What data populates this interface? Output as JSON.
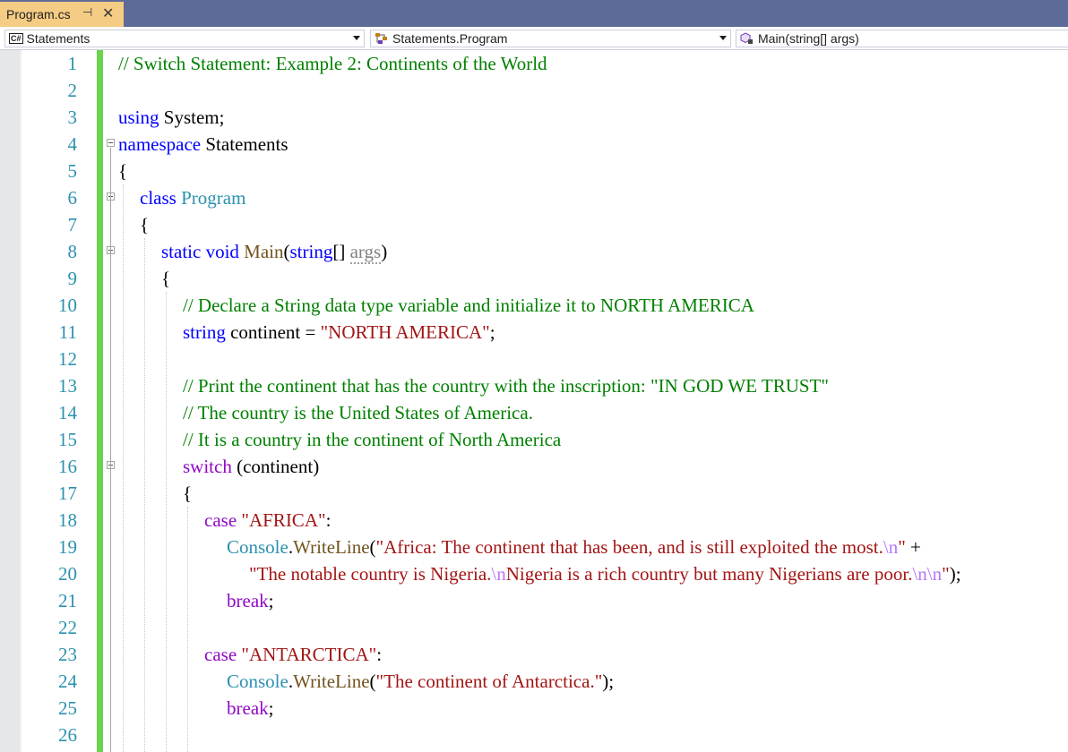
{
  "tab": {
    "title": "Program.cs",
    "pin_glyph": "⊣",
    "close_glyph": "✕"
  },
  "navbar": {
    "project": "Statements",
    "type": "Statements.Program",
    "member": "Main(string[] args)"
  },
  "lines": [
    {
      "n": "1",
      "indent": 0,
      "tokens": [
        [
          "c-comment",
          "// Switch Statement: Example 2: Continents of the World"
        ]
      ]
    },
    {
      "n": "2",
      "indent": 0,
      "tokens": []
    },
    {
      "n": "3",
      "indent": 0,
      "tokens": [
        [
          "c-kw",
          "using"
        ],
        [
          "",
          " System;"
        ]
      ]
    },
    {
      "n": "4",
      "indent": 0,
      "fold": true,
      "tokens": [
        [
          "c-kw",
          "namespace"
        ],
        [
          "",
          " Statements"
        ]
      ]
    },
    {
      "n": "5",
      "indent": 0,
      "tokens": [
        [
          "",
          "{"
        ]
      ]
    },
    {
      "n": "6",
      "indent": 1,
      "fold": true,
      "tokens": [
        [
          "c-kw",
          "class"
        ],
        [
          "",
          " "
        ],
        [
          "c-type",
          "Program"
        ]
      ]
    },
    {
      "n": "7",
      "indent": 1,
      "tokens": [
        [
          "",
          "{"
        ]
      ]
    },
    {
      "n": "8",
      "indent": 2,
      "fold": true,
      "tokens": [
        [
          "c-kw",
          "static"
        ],
        [
          "",
          " "
        ],
        [
          "c-kw",
          "void"
        ],
        [
          "",
          " "
        ],
        [
          "c-method",
          "Main"
        ],
        [
          "",
          "("
        ],
        [
          "c-kw",
          "string"
        ],
        [
          "",
          "[] "
        ],
        [
          "c-param",
          "args"
        ],
        [
          "",
          ")"
        ]
      ]
    },
    {
      "n": "9",
      "indent": 2,
      "tokens": [
        [
          "",
          "{"
        ]
      ]
    },
    {
      "n": "10",
      "indent": 3,
      "tokens": [
        [
          "c-comment",
          "// Declare a String data type variable and initialize it to NORTH AMERICA"
        ]
      ]
    },
    {
      "n": "11",
      "indent": 3,
      "tokens": [
        [
          "c-kw",
          "string"
        ],
        [
          "",
          " continent = "
        ],
        [
          "c-str",
          "\"NORTH AMERICA\""
        ],
        [
          "",
          ";"
        ]
      ]
    },
    {
      "n": "12",
      "indent": 3,
      "tokens": []
    },
    {
      "n": "13",
      "indent": 3,
      "tokens": [
        [
          "c-comment",
          "// Print the continent that has the country with the inscription: \"IN GOD WE TRUST\""
        ]
      ]
    },
    {
      "n": "14",
      "indent": 3,
      "tokens": [
        [
          "c-comment",
          "// The country is the United States of America."
        ]
      ]
    },
    {
      "n": "15",
      "indent": 3,
      "tokens": [
        [
          "c-comment",
          "// It is a country in the continent of North America"
        ]
      ]
    },
    {
      "n": "16",
      "indent": 3,
      "fold": true,
      "tokens": [
        [
          "c-ctrl",
          "switch"
        ],
        [
          "",
          " (continent)"
        ]
      ]
    },
    {
      "n": "17",
      "indent": 3,
      "tokens": [
        [
          "",
          "{"
        ]
      ]
    },
    {
      "n": "18",
      "indent": 4,
      "tokens": [
        [
          "c-ctrl",
          "case"
        ],
        [
          "",
          " "
        ],
        [
          "c-str",
          "\"AFRICA\""
        ],
        [
          "",
          ":"
        ]
      ]
    },
    {
      "n": "19",
      "indent": 5,
      "tokens": [
        [
          "c-type",
          "Console"
        ],
        [
          "",
          "."
        ],
        [
          "c-method",
          "WriteLine"
        ],
        [
          "",
          "("
        ],
        [
          "c-str",
          "\"Africa: The continent that has been, and is still exploited the most."
        ],
        [
          "c-esc",
          "\\n"
        ],
        [
          "c-str",
          "\""
        ],
        [
          "",
          " +"
        ]
      ]
    },
    {
      "n": "20",
      "indent": 6,
      "tokens": [
        [
          "c-str",
          "\"The notable country is Nigeria."
        ],
        [
          "c-esc",
          "\\n"
        ],
        [
          "c-str",
          "Nigeria is a rich country but many Nigerians are poor."
        ],
        [
          "c-esc",
          "\\n\\n"
        ],
        [
          "c-str",
          "\""
        ],
        [
          "",
          ");"
        ]
      ]
    },
    {
      "n": "21",
      "indent": 5,
      "tokens": [
        [
          "c-ctrl",
          "break"
        ],
        [
          "",
          ";"
        ]
      ]
    },
    {
      "n": "22",
      "indent": 5,
      "tokens": []
    },
    {
      "n": "23",
      "indent": 4,
      "tokens": [
        [
          "c-ctrl",
          "case"
        ],
        [
          "",
          " "
        ],
        [
          "c-str",
          "\"ANTARCTICA\""
        ],
        [
          "",
          ":"
        ]
      ]
    },
    {
      "n": "24",
      "indent": 5,
      "tokens": [
        [
          "c-type",
          "Console"
        ],
        [
          "",
          "."
        ],
        [
          "c-method",
          "WriteLine"
        ],
        [
          "",
          "("
        ],
        [
          "c-str",
          "\"The continent of Antarctica.\""
        ],
        [
          "",
          ");"
        ]
      ]
    },
    {
      "n": "25",
      "indent": 5,
      "tokens": [
        [
          "c-ctrl",
          "break"
        ],
        [
          "",
          ";"
        ]
      ]
    },
    {
      "n": "26",
      "indent": 5,
      "tokens": []
    }
  ]
}
